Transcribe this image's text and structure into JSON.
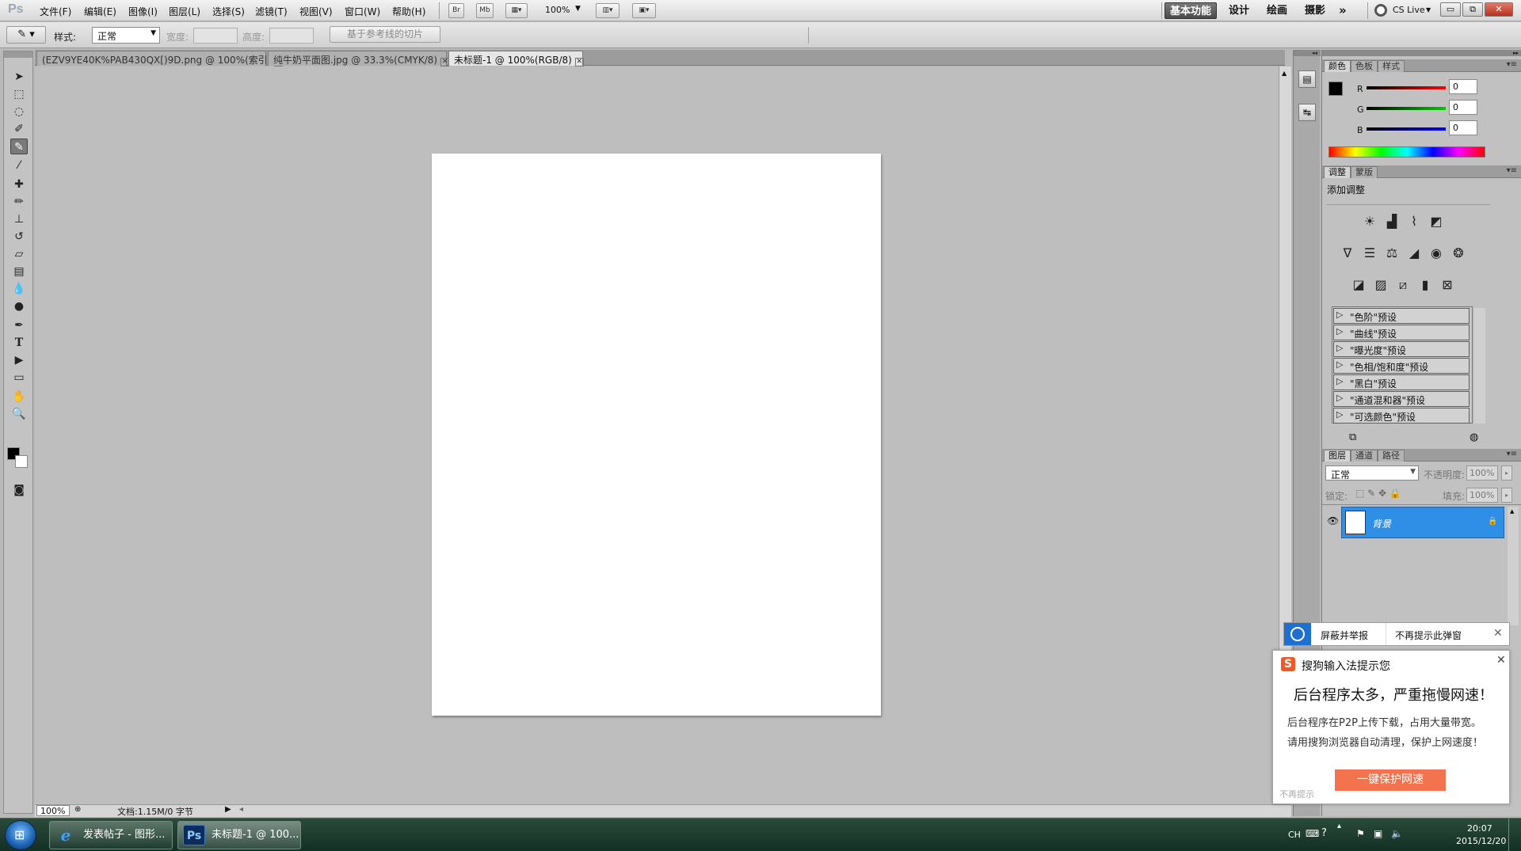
{
  "app": {
    "logo": "Ps"
  },
  "menu": [
    "文件(F)",
    "编辑(E)",
    "图像(I)",
    "图层(L)",
    "选择(S)",
    "滤镜(T)",
    "视图(V)",
    "窗口(W)",
    "帮助(H)"
  ],
  "menubar_icons": {
    "bridge": "Br",
    "minibridge": "Mb",
    "zoom": "100%"
  },
  "workspaces": [
    "基本功能",
    "设计",
    "绘画",
    "摄影"
  ],
  "workspace_more": "»",
  "cs_live": "CS Live",
  "window_controls": {
    "minimize": "▭",
    "restore": "⧉",
    "close": "✕"
  },
  "options": {
    "style_label": "样式:",
    "style_value": "正常",
    "width_label": "宽度:",
    "height_label": "高度:",
    "slice_button": "基于参考线的切片"
  },
  "tabs": [
    {
      "label": "(EZV9YE40K%PAB430QX[)9D.png @ 100%(索引)",
      "close": "✕"
    },
    {
      "label": "纯牛奶平面图.jpg @ 33.3%(CMYK/8)",
      "close": "✕"
    },
    {
      "label": "未标题-1 @ 100%(RGB/8)",
      "close": "✕"
    }
  ],
  "status": {
    "zoom": "100%",
    "doc_info": "文档:1.15M/0 字节"
  },
  "color_panel": {
    "tabs": [
      "颜色",
      "色板",
      "样式"
    ],
    "r_label": "R",
    "g_label": "G",
    "b_label": "B",
    "r": "0",
    "g": "0",
    "b": "0"
  },
  "adjust_panel": {
    "tabs": [
      "调整",
      "蒙版"
    ],
    "title": "添加调整",
    "presets": [
      "\"色阶\"预设",
      "\"曲线\"预设",
      "\"曝光度\"预设",
      "\"色相/饱和度\"预设",
      "\"黑白\"预设",
      "\"通道混和器\"预设",
      "\"可选颜色\"预设"
    ]
  },
  "layers_panel": {
    "tabs": [
      "图层",
      "通道",
      "路径"
    ],
    "blend_mode": "正常",
    "opacity_label": "不透明度:",
    "opacity": "100%",
    "lock_label": "锁定:",
    "fill_label": "填充:",
    "fill": "100%",
    "layer_name": "背景"
  },
  "notify_bar": {
    "block": "屏蔽并举报",
    "dont_show": "不再提示此弹窗",
    "close": "✕"
  },
  "sogou": {
    "title": "搜狗输入法提示您",
    "close": "✕",
    "headline": "后台程序太多，严重拖慢网速！",
    "line1": "后台程序在P2P上传下载，占用大量带宽。",
    "line2": "请用搜狗浏览器自动清理，保护上网速度！",
    "button": "一键保护网速",
    "no_remind": "不再提示"
  },
  "taskbar": {
    "tasks": [
      {
        "label": "发表帖子 - 图形...",
        "icon": "e"
      },
      {
        "label": "未标题-1 @ 100...",
        "icon": "Ps"
      }
    ],
    "lang": "CH",
    "time": "20:07",
    "date": "2015/12/20"
  },
  "colors": {
    "layer_selected": "#2f8ee6",
    "sogou_button": "#f3734e",
    "notify_icon": "#1f6fd1"
  }
}
